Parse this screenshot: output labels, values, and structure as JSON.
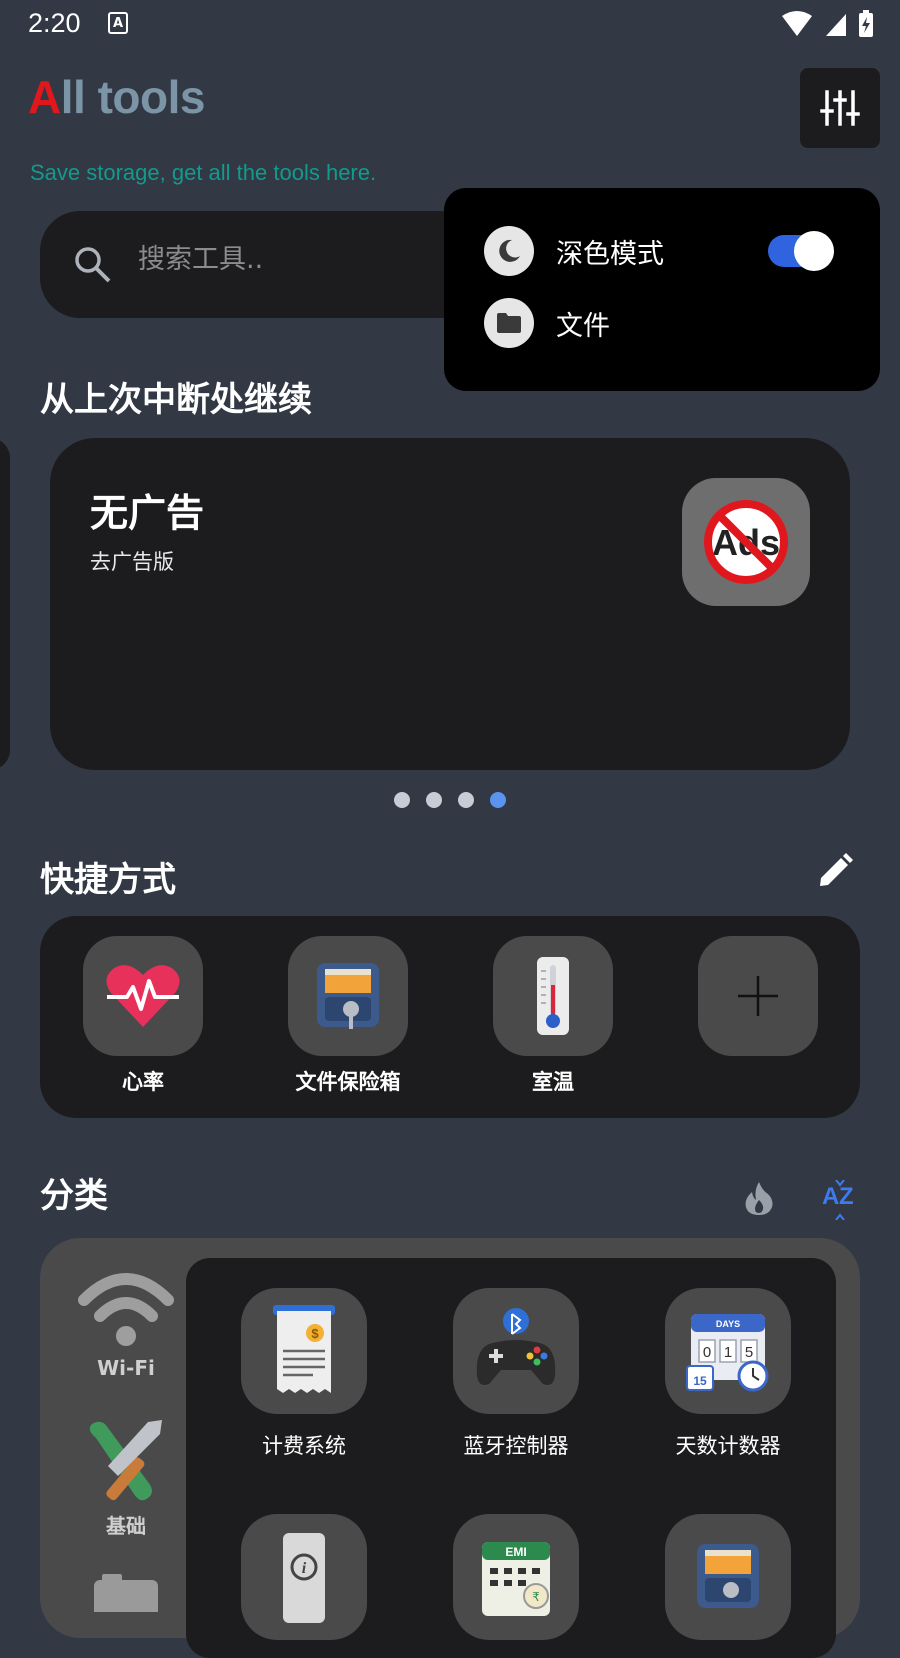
{
  "status_bar": {
    "time": "2:20",
    "notif_icon_letter": "A"
  },
  "header": {
    "title_first": "A",
    "title_rest": "ll tools",
    "subtitle": "Save storage, get all the tools here.",
    "settings_icon": "sliders-icon"
  },
  "search": {
    "placeholder": "搜索工具.."
  },
  "popup_menu": {
    "items": [
      {
        "label": "深色模式",
        "icon": "moon-icon",
        "toggle_on": true
      },
      {
        "label": "文件",
        "icon": "folder-icon"
      }
    ]
  },
  "continue_section": {
    "title": "从上次中断处继续",
    "card": {
      "title": "无广告",
      "subtitle": "去广告版",
      "badge_text": "Ads"
    },
    "pager": {
      "count": 4,
      "active_index": 3
    }
  },
  "shortcuts": {
    "title": "快捷方式",
    "edit_icon": "pencil-icon",
    "items": [
      {
        "label": "心率",
        "icon": "heart-rate-icon"
      },
      {
        "label": "文件保险箱",
        "icon": "file-vault-icon"
      },
      {
        "label": "室温",
        "icon": "thermometer-icon"
      },
      {
        "label": "",
        "icon": "plus-icon"
      }
    ]
  },
  "categories": {
    "title": "分类",
    "sort_hot_icon": "flame-icon",
    "sort_az_icon": "az-sort-icon",
    "side": [
      {
        "label": "Wi-Fi",
        "icon": "wifi-icon"
      },
      {
        "label": "基础",
        "icon": "tools-icon"
      },
      {
        "label": "",
        "icon": "camera-icon"
      }
    ],
    "tools": [
      {
        "label": "计费系统",
        "icon": "receipt-icon"
      },
      {
        "label": "蓝牙控制器",
        "icon": "gamepad-icon"
      },
      {
        "label": "天数计数器",
        "icon": "calendar-counter-icon"
      },
      {
        "label": "",
        "icon": "info-device-icon"
      },
      {
        "label": "",
        "icon": "emi-calendar-icon"
      },
      {
        "label": "",
        "icon": "file-vault-icon"
      }
    ],
    "counter_badge": "DAYS",
    "counter_digits": "015",
    "counter_date": "15",
    "emi_label": "EMI"
  }
}
